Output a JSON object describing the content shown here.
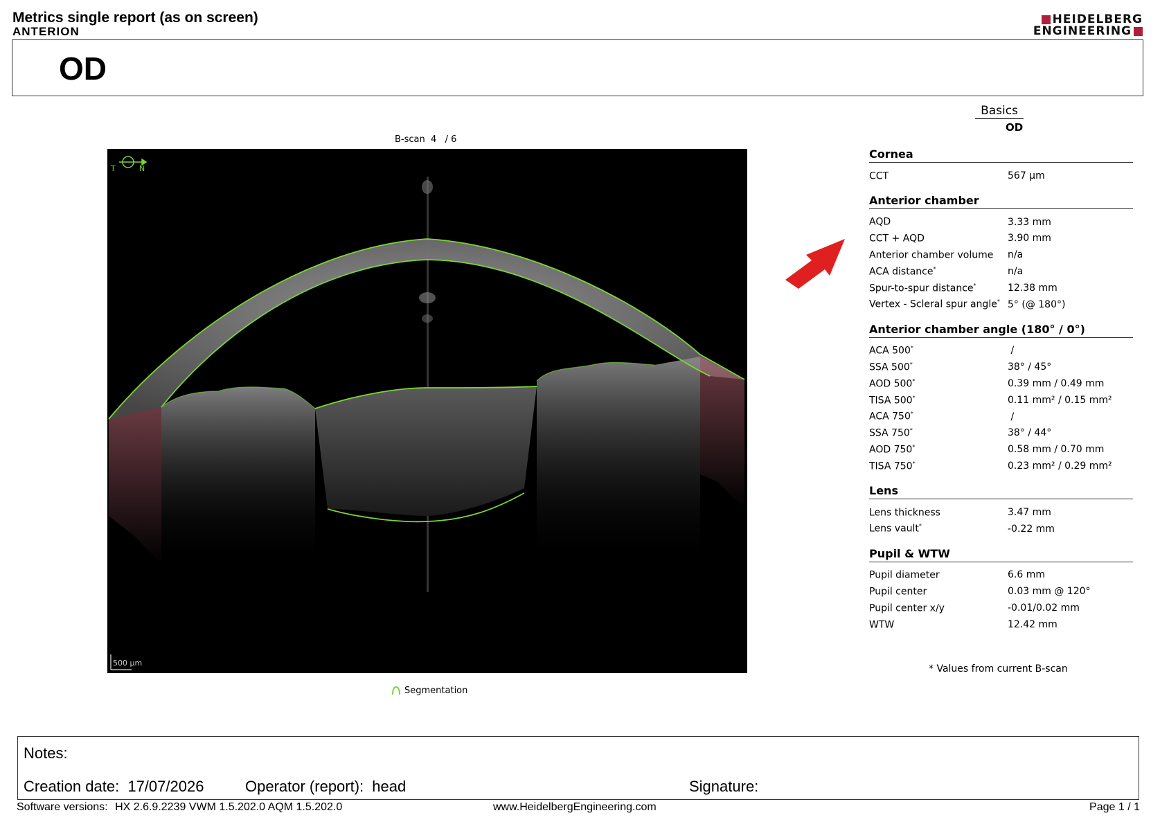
{
  "header": {
    "title": "Metrics single report (as on screen)",
    "product": "ANTERION",
    "logo_line1": "HEIDELBERG",
    "logo_line2": "ENGINEERING",
    "logo_accent_color": "#b0203a"
  },
  "eye": "OD",
  "scan": {
    "bscan_label": "B-scan  4   / 6",
    "orientation_left": "T",
    "orientation_right": "N",
    "scale_bar": "500 µm",
    "segmentation_legend": "Segmentation",
    "segmentation_color": "#7cd434",
    "angle_overlay_color": "#c06a78"
  },
  "basics": {
    "title": "Basics",
    "eye": "OD"
  },
  "sections": [
    {
      "title": "Cornea",
      "rows": [
        {
          "label": "CCT",
          "star": "",
          "value": "567 µm"
        }
      ]
    },
    {
      "title": "Anterior chamber",
      "rows": [
        {
          "label": "AQD",
          "star": "",
          "value": "3.33 mm"
        },
        {
          "label": "CCT + AQD",
          "star": "",
          "value": "3.90 mm"
        },
        {
          "label": "Anterior chamber volume",
          "star": "",
          "value": "n/a"
        },
        {
          "label": "ACA distance",
          "star": "*",
          "value": "n/a"
        },
        {
          "label": "Spur-to-spur distance",
          "star": "*",
          "value": "12.38 mm"
        },
        {
          "label": "Vertex - Scleral spur angle",
          "star": "*",
          "value": "5° (@ 180°)"
        }
      ]
    },
    {
      "title": "Anterior chamber angle (180° / 0°)",
      "rows": [
        {
          "label": "ACA 500",
          "star": "*",
          "value": " /"
        },
        {
          "label": "SSA 500",
          "star": "*",
          "value": "38° / 45°"
        },
        {
          "label": "AOD 500",
          "star": "*",
          "value": "0.39 mm / 0.49 mm"
        },
        {
          "label": "TISA 500",
          "star": "*",
          "value": "0.11 mm² / 0.15 mm²"
        },
        {
          "label": "ACA 750",
          "star": "*",
          "value": " /"
        },
        {
          "label": "SSA 750",
          "star": "*",
          "value": "38° / 44°"
        },
        {
          "label": "AOD 750",
          "star": "*",
          "value": "0.58 mm / 0.70 mm"
        },
        {
          "label": "TISA 750",
          "star": "*",
          "value": "0.23 mm² / 0.29 mm²"
        }
      ]
    },
    {
      "title": "Lens",
      "rows": [
        {
          "label": "Lens thickness",
          "star": "",
          "value": "3.47 mm"
        },
        {
          "label": "Lens vault",
          "star": "*",
          "value": "-0.22 mm"
        }
      ]
    },
    {
      "title": "Pupil & WTW",
      "rows": [
        {
          "label": "Pupil diameter",
          "star": "",
          "value": "6.6 mm"
        },
        {
          "label": "Pupil center",
          "star": "",
          "value": "0.03 mm @ 120°"
        },
        {
          "label": "Pupil center x/y",
          "star": "",
          "value": "-0.01/0.02 mm"
        },
        {
          "label": "WTW",
          "star": "",
          "value": "12.42 mm"
        }
      ]
    }
  ],
  "footnote": "* Values from current B-scan",
  "annotation_arrow_color": "#e02020",
  "notes": {
    "label": "Notes:",
    "creation_date_label": "Creation date:",
    "creation_date": "17/07/2026",
    "operator_label": "Operator (report):",
    "operator": "head",
    "signature_label": "Signature:"
  },
  "footer": {
    "software_label": "Software versions:",
    "software_versions": "HX 2.6.9.2239 VWM 1.5.202.0  AQM 1.5.202.0",
    "website": "www.HeidelbergEngineering.com",
    "page": "Page  1 / 1"
  }
}
